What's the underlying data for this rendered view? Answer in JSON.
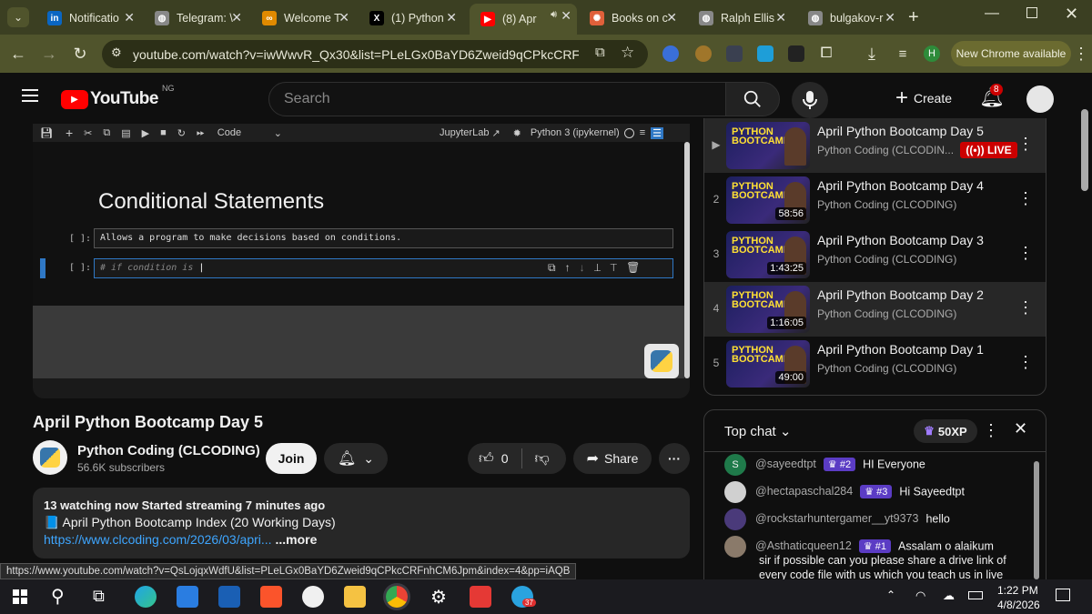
{
  "browser": {
    "tabs": [
      {
        "title": "Notificatio",
        "icon": "linkedin-icon",
        "color": "#0a66c2",
        "glyph": "in"
      },
      {
        "title": "Telegram: \\",
        "icon": "globe-icon",
        "color": "#888888",
        "glyph": "◍"
      },
      {
        "title": "Welcome T",
        "icon": "coursera-icon",
        "color": "#e08a00",
        "glyph": "∞"
      },
      {
        "title": "(1) Python",
        "icon": "x-icon",
        "color": "#000000",
        "glyph": "X"
      },
      {
        "title": "(8) Apr",
        "icon": "youtube-icon",
        "color": "#ff0000",
        "glyph": "▶"
      },
      {
        "title": "Books on c",
        "icon": "asterisk-icon",
        "color": "#e0603a",
        "glyph": "✺"
      },
      {
        "title": "Ralph Ellis",
        "icon": "globe-icon",
        "color": "#888888",
        "glyph": "◍"
      },
      {
        "title": "bulgakov-r",
        "icon": "globe-icon",
        "color": "#888888",
        "glyph": "◍"
      }
    ],
    "url": "youtube.com/watch?v=iwWwvR_Qx30&list=PLeLGx0BaYD6Zweid9qCPkcCRFnhCM...",
    "chrome_available": "New Chrome available",
    "profile_initial": "H"
  },
  "youtube": {
    "logo": "YouTube",
    "region": "NG",
    "search_placeholder": "Search",
    "create_label": "Create",
    "notifications": "8"
  },
  "notebook": {
    "toolbar_mode": "Code",
    "jupyterlab": "JupyterLab",
    "kernel": "Python 3 (ipykernel)",
    "heading": "Conditional Statements",
    "prompt1": "[ ]:",
    "cell1": "Allows a program to make decisions based on conditions.",
    "prompt2": "[ ]:",
    "cell2": "# if condition is "
  },
  "playlist": [
    {
      "index": "▶",
      "title": "April Python Bootcamp Day 5",
      "channel": "Python Coding (CLCODIN...",
      "badge": "LIVE",
      "duration": ""
    },
    {
      "index": "2",
      "title": "April Python Bootcamp Day 4",
      "channel": "Python Coding (CLCODING)",
      "badge": "",
      "duration": "58:56"
    },
    {
      "index": "3",
      "title": "April Python Bootcamp Day 3",
      "channel": "Python Coding (CLCODING)",
      "badge": "",
      "duration": "1:43:25"
    },
    {
      "index": "4",
      "title": "April Python Bootcamp Day 2",
      "channel": "Python Coding (CLCODING)",
      "badge": "",
      "duration": "1:16:05"
    },
    {
      "index": "5",
      "title": "April Python Bootcamp Day 1",
      "channel": "Python Coding (CLCODING)",
      "badge": "",
      "duration": "49:00"
    }
  ],
  "video": {
    "title": "April Python Bootcamp Day 5",
    "channel": "Python Coding (CLCODING)",
    "subscribers": "56.6K subscribers",
    "join": "Join",
    "likes": "0",
    "share": "Share",
    "desc_stats": "13 watching now  Started streaming 7 minutes ago",
    "desc_line2": "📘 April Python Bootcamp Index (20 Working Days)",
    "desc_link": "https://www.clcoding.com/2026/03/apri...",
    "desc_more": "...more"
  },
  "chat": {
    "header": "Top chat",
    "xp": "50XP",
    "messages": [
      {
        "author": "@sayeedtpt",
        "rank": "#2",
        "text": "HI Everyone",
        "avatar": "S",
        "avcolor": "#1f7a4a"
      },
      {
        "author": "@hectapaschal284",
        "rank": "#3",
        "text": "Hi Sayeedtpt",
        "avatar": "",
        "avcolor": "#d0d0d0"
      },
      {
        "author": "@rockstarhuntergamer__yt9373",
        "rank": "",
        "text": "hello",
        "avatar": "",
        "avcolor": "#4a3a7a"
      },
      {
        "author": "@Asthaticqueen12",
        "rank": "#1",
        "text": "Assalam o alaikum",
        "avatar": "",
        "avcolor": "#8a7a6a"
      }
    ],
    "msg_cont1": "sir if possible can you please share a drive link of",
    "msg_cont2": "every code file with us which you teach us in live"
  },
  "status_url": "https://www.youtube.com/watch?v=QsLojqxWdfU&list=PLeLGx0BaYD6Zweid9qCPkcCRFnhCM6Jpm&index=4&pp=iAQB",
  "taskbar": {
    "time": "1:22 PM",
    "date": "4/8/2026",
    "telegram_badge": "37"
  }
}
